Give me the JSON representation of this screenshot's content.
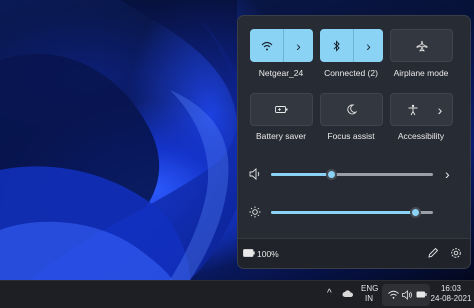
{
  "quick_settings": {
    "tiles": [
      {
        "label": "Netgear_24",
        "icon": "wifi-icon",
        "state": "on",
        "has_arrow": true
      },
      {
        "label": "Connected (2)",
        "icon": "bluetooth-icon",
        "state": "on",
        "has_arrow": true
      },
      {
        "label": "Airplane mode",
        "icon": "airplane-icon",
        "state": "off",
        "has_arrow": false
      },
      {
        "label": "Battery saver",
        "icon": "battery-saver-icon",
        "state": "off",
        "has_arrow": false
      },
      {
        "label": "Focus assist",
        "icon": "moon-icon",
        "state": "off",
        "has_arrow": false
      },
      {
        "label": "Accessibility",
        "icon": "accessibility-icon",
        "state": "off",
        "has_arrow": true
      }
    ],
    "volume": {
      "icon": "speaker-icon",
      "level": 0.37
    },
    "brightness": {
      "icon": "brightness-icon",
      "level": 0.89
    },
    "footer": {
      "battery_percent": "100%",
      "icons": [
        "battery-icon",
        "edit-icon",
        "gear-icon"
      ]
    }
  },
  "taskbar": {
    "language_top": "ENG",
    "language_bottom": "IN",
    "time": "16:03",
    "date": "24-08-2021",
    "tray_icons": [
      "chevron-up-icon",
      "cloud-icon",
      "wifi-icon",
      "speaker-icon",
      "battery-icon"
    ]
  },
  "colors": {
    "accent": "#8ad3f5",
    "flyout_bg": "#272b33",
    "taskbar_bg": "#1e1f24"
  }
}
